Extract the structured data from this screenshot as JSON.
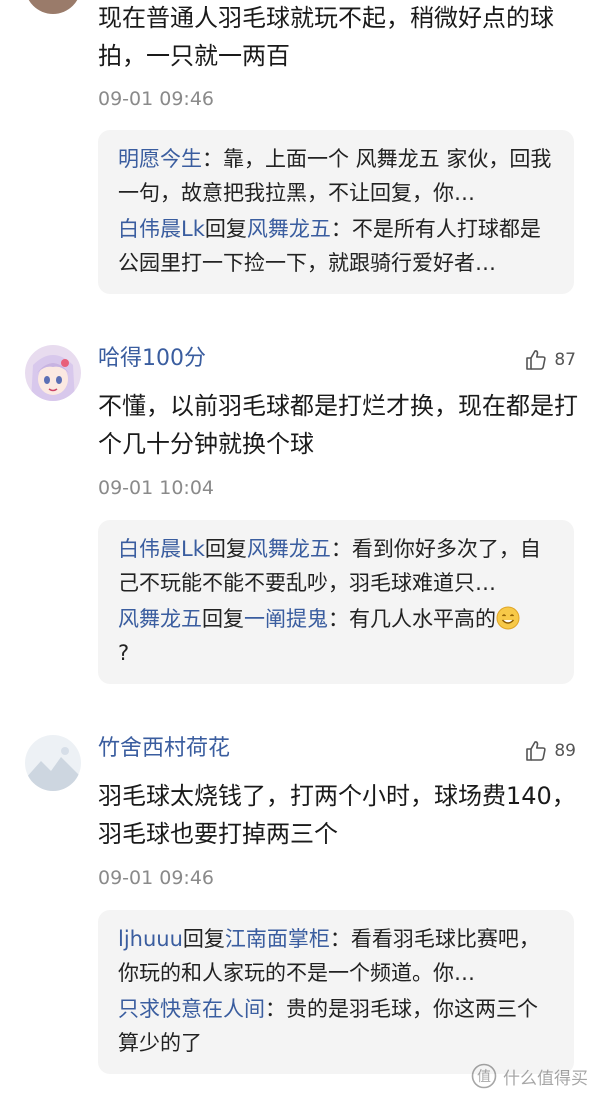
{
  "comments": [
    {
      "text": "现在普通人羽毛球就玩不起，稍微好点的球拍，一只就一两百",
      "time": "09-01 09:46",
      "replies": [
        {
          "user": "明愿今生",
          "connector": "",
          "target": "",
          "content": "：靠，上面一个 风舞龙五 家伙，回我一句，故意把我拉黑，不让回复，你…"
        },
        {
          "user": "白伟晨Lk",
          "connector": "回复",
          "target": "风舞龙五",
          "content": "：不是所有人打球都是公园里打一下捡一下，就跟骑行爱好者…"
        }
      ]
    },
    {
      "user": "哈得100分",
      "likes": "87",
      "text": "不懂，以前羽毛球都是打烂才换，现在都是打个几十分钟就换个球",
      "time": "09-01 10:04",
      "replies": [
        {
          "user": "白伟晨Lk",
          "connector": "回复",
          "target": "风舞龙五",
          "content": "：看到你好多次了，自己不玩能不能不要乱吵，羽毛球难道只…"
        },
        {
          "user": "风舞龙五",
          "connector": "回复",
          "target": "一阐提鬼",
          "content": "：有几人水平高的",
          "tail": "?"
        }
      ]
    },
    {
      "user": "竹舍西村荷花",
      "likes": "89",
      "text": "羽毛球太烧钱了，打两个小时，球场费140，羽毛球也要打掉两三个",
      "time": "09-01 09:46",
      "replies": [
        {
          "user": "ljhuuu",
          "connector": "回复",
          "target": "江南面掌柜",
          "content": "：看看羽毛球比赛吧，你玩的和人家玩的不是一个频道。你…"
        },
        {
          "user": "只求快意在人间",
          "connector": "",
          "target": "",
          "content": "：贵的是羽毛球，你这两三个 算少的了"
        }
      ]
    }
  ],
  "watermark": "什么值得买",
  "icons": {
    "like": "thumbs-up-icon",
    "emoji": "smile-emoji-icon",
    "watermark": "smzdm-logo-icon"
  },
  "colors": {
    "username": "#3a5d9f",
    "time": "#8a8a8a",
    "reply_bg": "#f4f4f4"
  }
}
